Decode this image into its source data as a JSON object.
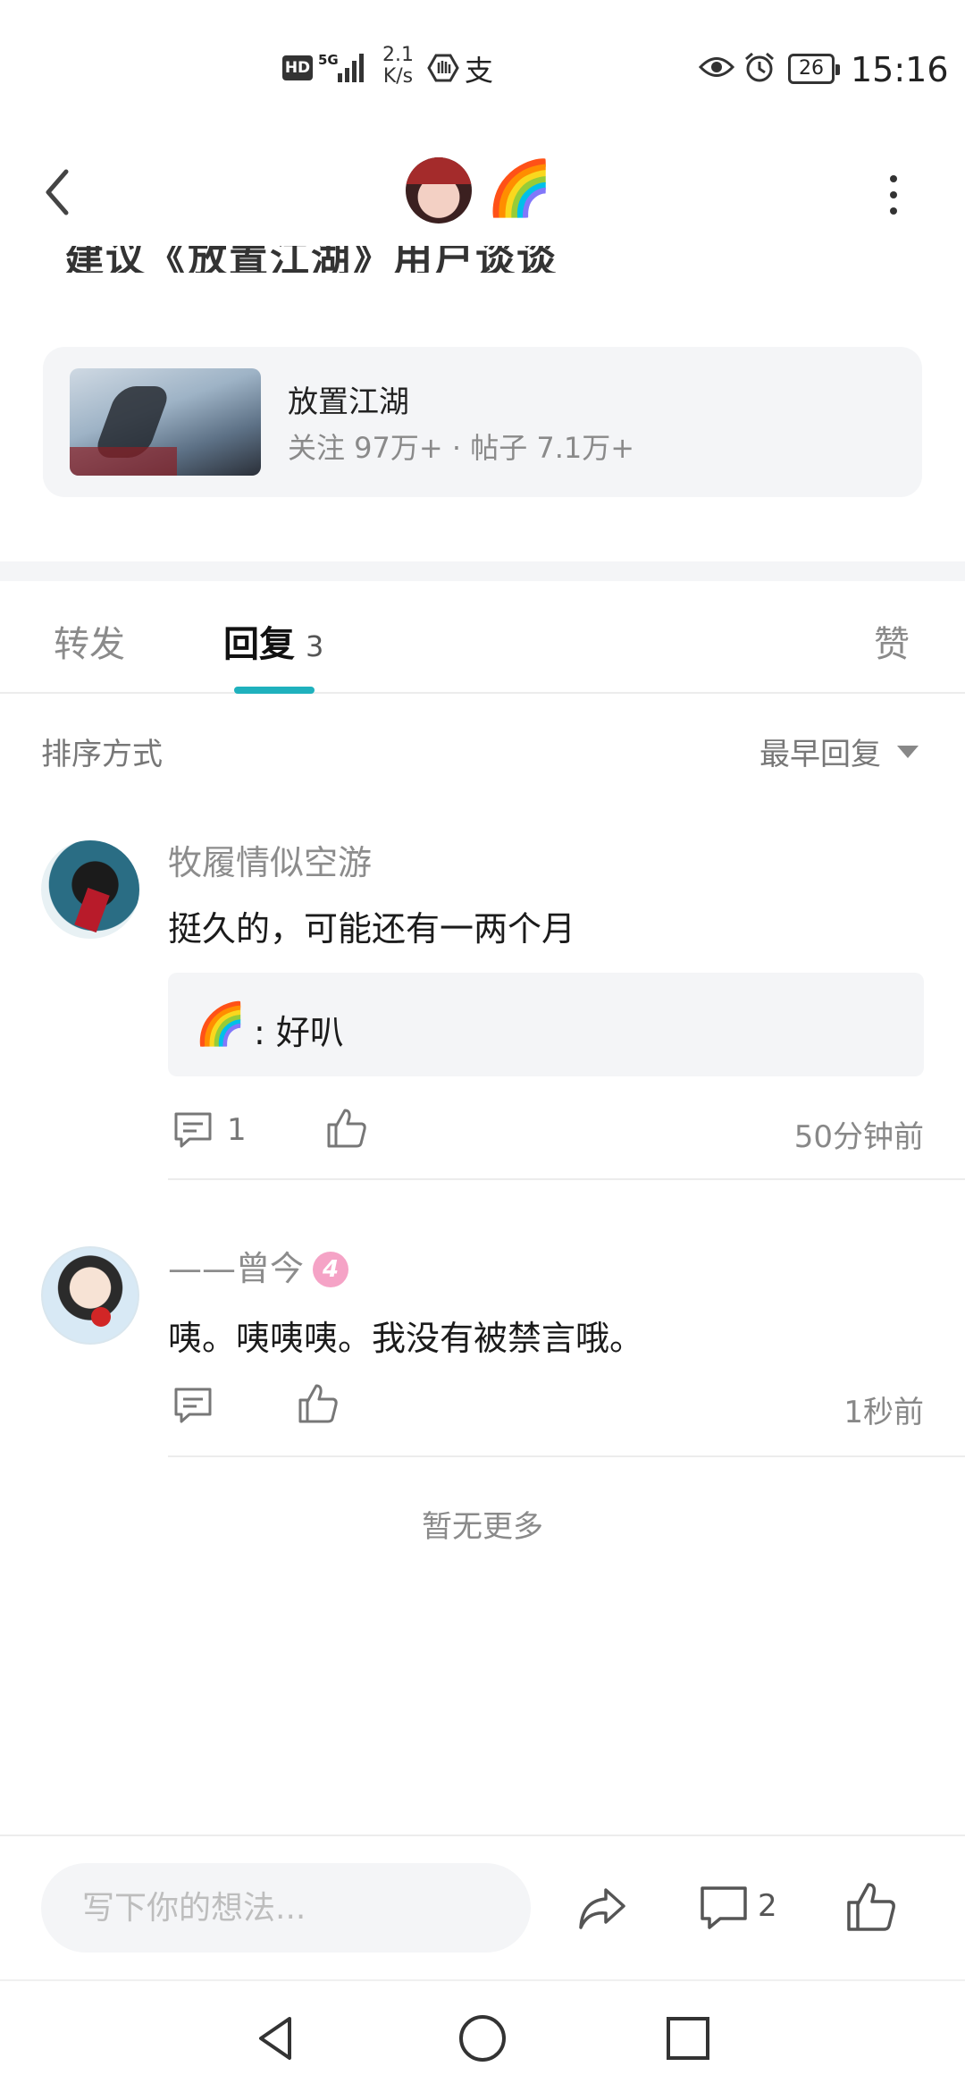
{
  "status_bar": {
    "hd": "HD",
    "signal_label": "5G",
    "net_speed_value": "2.1",
    "net_speed_unit": "K/s",
    "alipay_glyph": "支",
    "battery": "26",
    "time": "15:16"
  },
  "header": {
    "author_emoji": "🌈",
    "truncated_text": "建议《放置江湖》用户谈谈的，"
  },
  "topic": {
    "title": "放置江湖",
    "stats": "关注 97万+  ·  帖子 7.1万+"
  },
  "tabs": {
    "forward": "转发",
    "reply": "回复",
    "reply_count": "3",
    "like": "赞"
  },
  "sort": {
    "label": "排序方式",
    "value": "最早回复"
  },
  "comments": [
    {
      "name": "牧履情似空游",
      "text": "挺久的，可能还有一两个月",
      "sub_reply_author": "🌈",
      "sub_reply_text": ": 好叭",
      "reply_count": "1",
      "time": "50分钟前"
    },
    {
      "name": "——曾今",
      "level": "4",
      "text": "咦。咦咦咦。我没有被禁言哦。",
      "time": "1秒前"
    }
  ],
  "no_more": "暂无更多",
  "bottom_bar": {
    "input_placeholder": "写下你的想法...",
    "comment_count": "2"
  },
  "colors": {
    "accent": "#1fb1bd",
    "muted_text": "#8a8a8a",
    "card_bg": "#f4f5f7",
    "level_badge": "#f5a3c6"
  },
  "icons": [
    "back-arrow-icon",
    "more-vertical-icon",
    "comment-icon",
    "thumbs-up-icon",
    "share-icon",
    "nav-back-icon",
    "nav-home-icon",
    "nav-recents-icon"
  ]
}
